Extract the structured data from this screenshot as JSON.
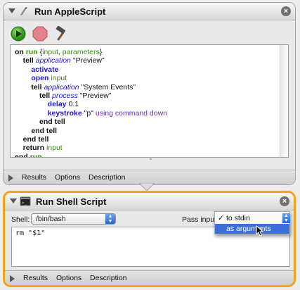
{
  "applescript_action": {
    "title": "Run AppleScript",
    "close_glyph": "×",
    "tools": [
      "run-icon",
      "stop-icon",
      "compile-hammer-icon"
    ],
    "code_lines": [
      [
        {
          "t": "on ",
          "c": "kw"
        },
        {
          "t": "run ",
          "c": "var-kw"
        },
        {
          "t": "{",
          "c": "plain"
        },
        {
          "t": "input",
          "c": "var"
        },
        {
          "t": ", ",
          "c": "plain"
        },
        {
          "t": "parameters",
          "c": "var"
        },
        {
          "t": "}",
          "c": "plain"
        }
      ],
      [
        {
          "t": "    tell ",
          "c": "kw"
        },
        {
          "t": "application ",
          "c": "app"
        },
        {
          "t": "\"Preview\"",
          "c": "plain"
        }
      ],
      [
        {
          "t": "        activate",
          "c": "cmd"
        }
      ],
      [
        {
          "t": "        open ",
          "c": "cmd"
        },
        {
          "t": "input",
          "c": "var"
        }
      ],
      [
        {
          "t": "        tell ",
          "c": "kw"
        },
        {
          "t": "application ",
          "c": "app"
        },
        {
          "t": "\"System Events\"",
          "c": "plain"
        }
      ],
      [
        {
          "t": "            tell ",
          "c": "kw"
        },
        {
          "t": "process ",
          "c": "app"
        },
        {
          "t": "\"Preview\"",
          "c": "plain"
        }
      ],
      [
        {
          "t": "                delay ",
          "c": "cmd"
        },
        {
          "t": "0.1",
          "c": "plain"
        }
      ],
      [
        {
          "t": "                keystroke ",
          "c": "cmd"
        },
        {
          "t": "\"p\" ",
          "c": "plain"
        },
        {
          "t": "using ",
          "c": "param"
        },
        {
          "t": "command down",
          "c": "param"
        }
      ],
      [
        {
          "t": "            end tell",
          "c": "kw"
        }
      ],
      [
        {
          "t": "        end tell",
          "c": "kw"
        }
      ],
      [
        {
          "t": "    end tell",
          "c": "kw"
        }
      ],
      [
        {
          "t": "    return ",
          "c": "kw"
        },
        {
          "t": "input",
          "c": "var"
        }
      ],
      [
        {
          "t": "end ",
          "c": "kw"
        },
        {
          "t": "run",
          "c": "var-kw"
        }
      ]
    ],
    "footer_tabs": [
      "Results",
      "Options",
      "Description"
    ]
  },
  "shell_action": {
    "title": "Run Shell Script",
    "close_glyph": "×",
    "shell_label": "Shell:",
    "shell_value": "/bin/bash",
    "pass_input_label": "Pass input",
    "pass_input_menu": {
      "options": [
        "to stdin",
        "as arguments"
      ],
      "checked": "to stdin",
      "highlighted": "as arguments",
      "check_glyph": "✓"
    },
    "script_text": "rm \"$1\"",
    "footer_tabs": [
      "Results",
      "Options",
      "Description"
    ]
  },
  "colors": {
    "selected_action_border": "#f2a31a",
    "keyword_blue": "#1f17d8",
    "variable_green": "#3a8f13",
    "menu_highlight": "#3b6fd8"
  }
}
